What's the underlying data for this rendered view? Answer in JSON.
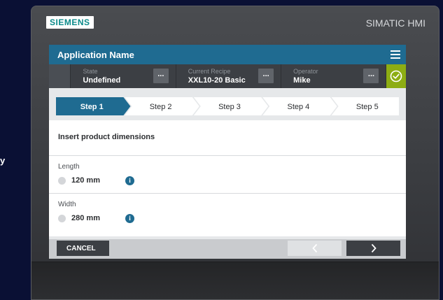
{
  "background_mark": "y",
  "device": {
    "brand": "SIEMENS",
    "model": "SIMATIC HMI"
  },
  "app": {
    "title": "Application Name",
    "menu_icon": "hamburger-menu-icon"
  },
  "info_bar": {
    "state": {
      "label": "State",
      "value": "Undefined"
    },
    "recipe": {
      "label": "Current Recipe",
      "value": "XXL10-20 Basic"
    },
    "operator": {
      "label": "Operator",
      "value": "Mike"
    },
    "more_label": "...",
    "status_icon": "checkmark-circle-icon"
  },
  "steps": [
    {
      "label": "Step 1",
      "active": true
    },
    {
      "label": "Step 2",
      "active": false
    },
    {
      "label": "Step 3",
      "active": false
    },
    {
      "label": "Step 4",
      "active": false
    },
    {
      "label": "Step 5",
      "active": false
    }
  ],
  "form": {
    "title": "Insert product dimensions",
    "fields": [
      {
        "label": "Length",
        "value": "120 mm"
      },
      {
        "label": "Width",
        "value": "280 mm"
      }
    ],
    "info_glyph": "i"
  },
  "footer": {
    "cancel_label": "CANCEL",
    "prev_icon": "chevron-left-icon",
    "next_icon": "chevron-right-icon"
  },
  "colors": {
    "primary": "#1f6b91",
    "dark": "#3c3f44",
    "ok": "#8dad13",
    "brand": "#0b8a8a"
  }
}
